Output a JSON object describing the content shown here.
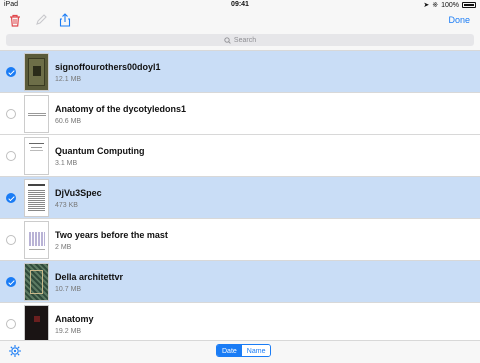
{
  "status_bar": {
    "carrier": "iPad",
    "time": "09:41",
    "battery": "100%"
  },
  "toolbar": {
    "done_label": "Done",
    "icons": [
      "trash-icon",
      "pencil-icon",
      "share-icon"
    ]
  },
  "search": {
    "placeholder": "Search"
  },
  "files": [
    {
      "title": "signoffourothers00doyl1",
      "size": "12.1 MB",
      "selected": true
    },
    {
      "title": "Anatomy of the dycotyledons1",
      "size": "60.6 MB",
      "selected": false
    },
    {
      "title": "Quantum Computing",
      "size": "3.1 MB",
      "selected": false
    },
    {
      "title": "DjVu3Spec",
      "size": "473 KB",
      "selected": true
    },
    {
      "title": "Two years before the mast",
      "size": "2 MB",
      "selected": false
    },
    {
      "title": "Della architettvr",
      "size": "10.7 MB",
      "selected": true
    },
    {
      "title": "Anatomy",
      "size": "19.2 MB",
      "selected": false
    }
  ],
  "sort": {
    "date_label": "Date",
    "name_label": "Name",
    "active": "Date"
  },
  "colors": {
    "accent": "#1a7cf5",
    "selected_row": "#c9ddf6",
    "delete": "#e0474c"
  }
}
